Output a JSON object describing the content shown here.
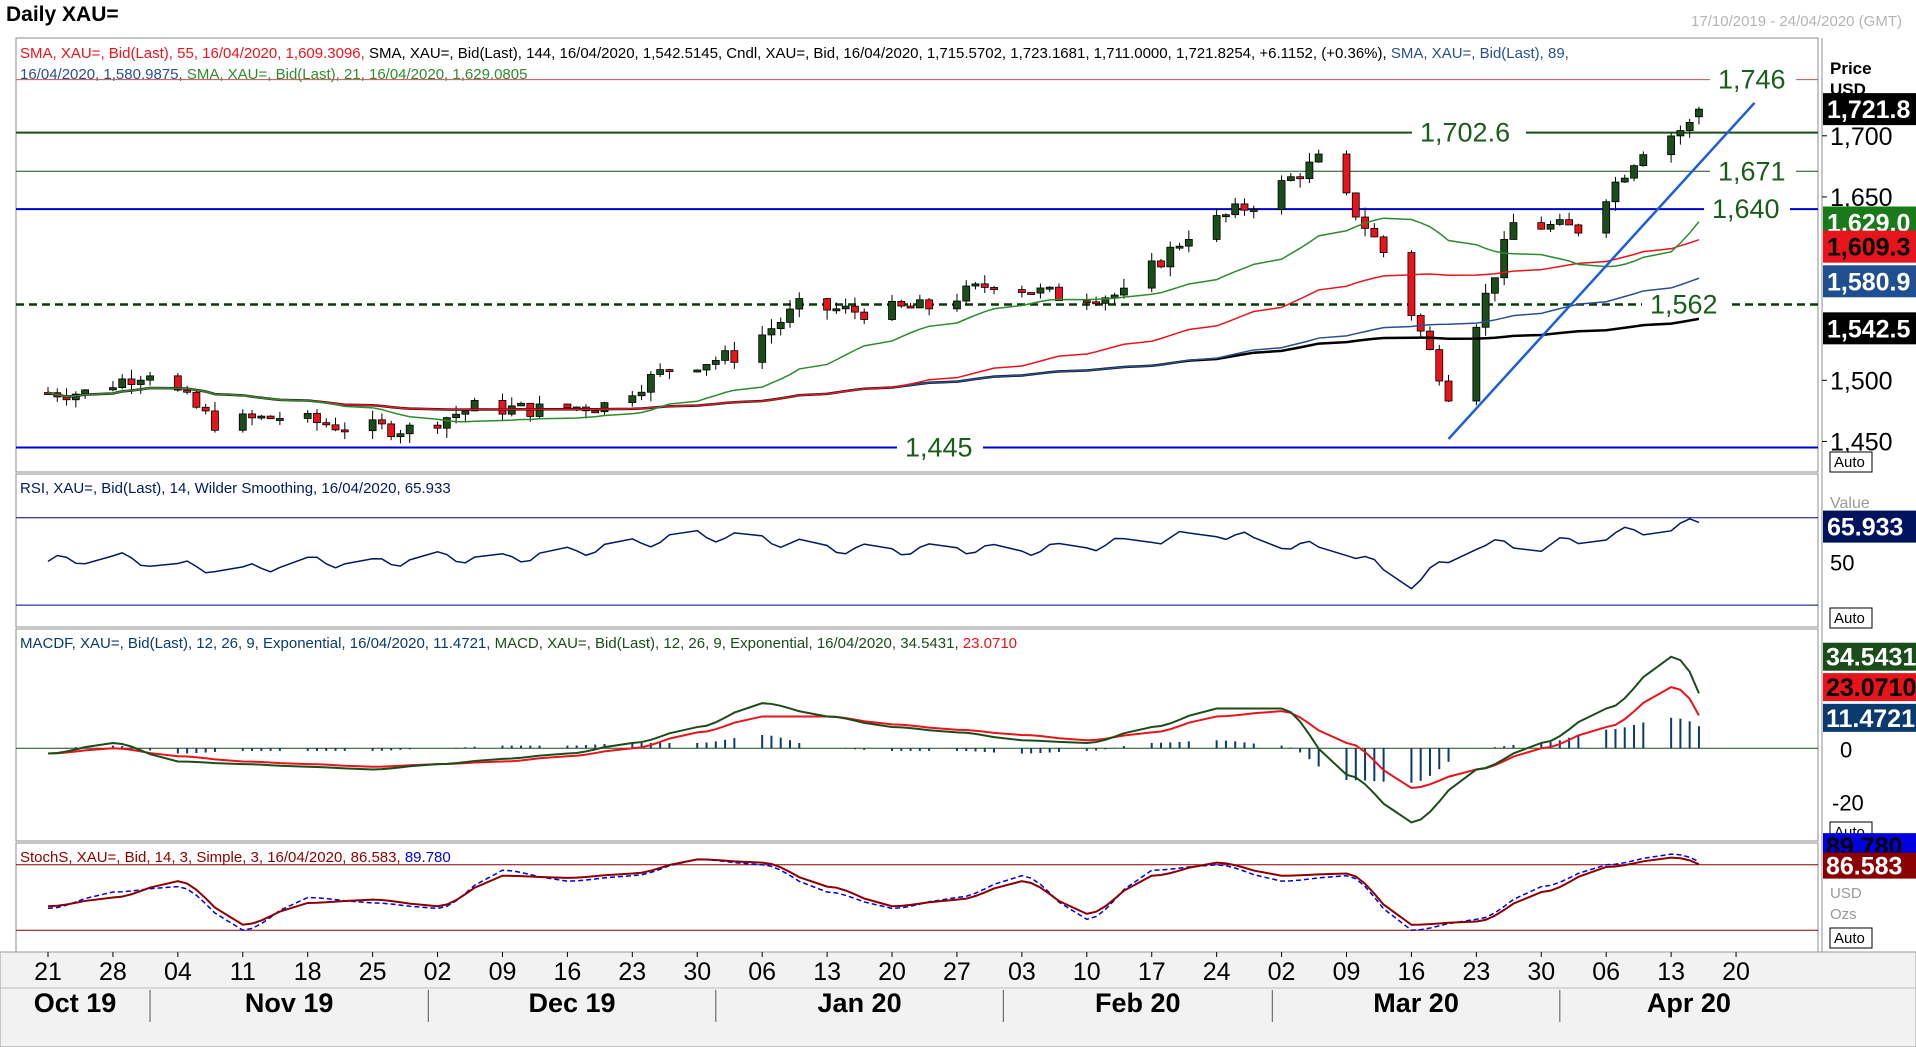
{
  "title": "Daily XAU=",
  "date_range": "17/10/2019 - 24/04/2020 (GMT)",
  "colors": {
    "up": "#1a4d1a",
    "down": "#e8141c",
    "sma21": "#2e8b2e",
    "sma55": "#e8141c",
    "sma89": "#2a4f8f",
    "sma144": "#000000",
    "support": "#0000cc",
    "level_green": "#1a5c1a",
    "trend": "#1f5fd6",
    "rsi": "#001a66",
    "macdf": "#0a3a6e",
    "macd": "#1a4d1a",
    "signal": "#e8141c",
    "stochk": "#0000e0",
    "stochd": "#8b0000"
  },
  "legends": {
    "price_1": [
      {
        "text": "SMA, XAU=, Bid(Last),   55, 16/04/2020, 1,609.3096, ",
        "color": "#e8141c"
      },
      {
        "text": "SMA, XAU=, Bid(Last),   144, 16/04/2020, 1,542.5145, ",
        "color": "#000000"
      },
      {
        "text": "Cndl, XAU=, Bid, 16/04/2020, 1,715.5702, 1,723.1681, 1,711.0000, 1,721.8254, +6.1152, (+0.36%), ",
        "color": "#000000"
      },
      {
        "text": "SMA, XAU=, Bid(Last),   89,",
        "color": "#2a4f8f"
      }
    ],
    "price_2": [
      {
        "text": "16/04/2020, 1,580.9875, ",
        "color": "#2a4f8f"
      },
      {
        "text": "SMA, XAU=, Bid(Last),   21, 16/04/2020, 1,629.0805",
        "color": "#2e8b2e"
      }
    ],
    "rsi": "RSI, XAU=, Bid(Last),   14, Wilder Smoothing, 16/04/2020, 65.933",
    "macd": [
      {
        "text": "MACDF, XAU=, Bid(Last),   12, 26, 9, Exponential, 16/04/2020, 11.4721, ",
        "color": "#0a3a6e"
      },
      {
        "text": "MACD, XAU=, Bid(Last),   12, 26, 9, Exponential, 16/04/2020, 34.5431, ",
        "color": "#1a4d1a"
      },
      {
        "text": "23.0710",
        "color": "#e8141c"
      }
    ],
    "stoch": [
      {
        "text": "StochS, XAU=, Bid,   14, 3, Simple, 3, 16/04/2020, 86.583, ",
        "color": "#8b0000"
      },
      {
        "text": "89.780",
        "color": "#0000e0"
      }
    ]
  },
  "axis": {
    "price_header": "Price",
    "price_unit": "USD",
    "price_ticks": [
      "1,700",
      "1,650",
      "1,500",
      "1,450"
    ],
    "rsi_header": "Value",
    "rsi_unit": "USD",
    "rsi_ticks": [
      "50"
    ],
    "macd_ticks": [
      "0",
      "-20"
    ],
    "stoch_unit_1": "USD",
    "stoch_unit_2": "Ozs",
    "auto": "Auto"
  },
  "badges": {
    "price": [
      {
        "text": "1,721.8",
        "bg": "#000000",
        "fg": "#ffffff"
      },
      {
        "text": "1,629.0",
        "bg": "#1a7a1a",
        "fg": "#ffffff"
      },
      {
        "text": "1,609.3",
        "bg": "#e8141c",
        "fg": "#000000"
      },
      {
        "text": "1,580.9",
        "bg": "#1f4f8f",
        "fg": "#ffffff"
      },
      {
        "text": "1,542.5",
        "bg": "#000000",
        "fg": "#ffffff"
      }
    ],
    "rsi": {
      "text": "65.933",
      "bg": "#00135c",
      "fg": "#ffffff"
    },
    "macd": [
      {
        "text": "34.5431",
        "bg": "#1a4d1a",
        "fg": "#ffffff"
      },
      {
        "text": "23.0710",
        "bg": "#e8141c",
        "fg": "#000000"
      },
      {
        "text": "11.4721",
        "bg": "#0a3a6e",
        "fg": "#ffffff"
      }
    ],
    "stoch": [
      {
        "text": "89.780",
        "bg": "#0000e0",
        "fg": "#000000"
      },
      {
        "text": "86.583",
        "bg": "#8b0000",
        "fg": "#ffffff"
      }
    ]
  },
  "levels": [
    {
      "value": 1746,
      "label": "1,746",
      "color": "#c85050",
      "style": "thin"
    },
    {
      "value": 1702.6,
      "label": "1,702.6",
      "color": "#1a4d1a",
      "style": "solid"
    },
    {
      "value": 1671,
      "label": "1,671",
      "color": "#1a4d1a",
      "style": "thin"
    },
    {
      "value": 1640,
      "label": "1,640",
      "color": "#0000cc",
      "style": "solid"
    },
    {
      "value": 1562,
      "label": "1,562",
      "color": "#0a3a0a",
      "style": "dashed"
    },
    {
      "value": 1445,
      "label": "1,445",
      "color": "#0000cc",
      "style": "solid"
    }
  ],
  "x_axis": {
    "days": [
      "21",
      "28",
      "04",
      "11",
      "18",
      "25",
      "02",
      "09",
      "16",
      "23",
      "30",
      "06",
      "13",
      "20",
      "27",
      "03",
      "10",
      "17",
      "24",
      "02",
      "09",
      "16",
      "23",
      "30",
      "06",
      "13",
      "20"
    ],
    "months": [
      "Oct 19",
      "Nov 19",
      "Dec 19",
      "Jan 20",
      "Feb 20",
      "Mar 20",
      "Apr 20"
    ]
  },
  "chart_data": [
    {
      "type": "candlestick",
      "title": "Daily XAU=",
      "ylabel": "Price USD",
      "ylim": [
        1425,
        1780
      ],
      "x": [
        "2019-10-21",
        "2019-10-28",
        "2019-11-04",
        "2019-11-11",
        "2019-11-18",
        "2019-11-25",
        "2019-12-02",
        "2019-12-09",
        "2019-12-16",
        "2019-12-23",
        "2019-12-30",
        "2020-01-06",
        "2020-01-13",
        "2020-01-20",
        "2020-01-27",
        "2020-02-03",
        "2020-02-10",
        "2020-02-17",
        "2020-02-24",
        "2020-03-02",
        "2020-03-09",
        "2020-03-16",
        "2020-03-23",
        "2020-03-30",
        "2020-04-06",
        "2020-04-13"
      ],
      "close": [
        1490,
        1508,
        1465,
        1470,
        1462,
        1460,
        1478,
        1476,
        1480,
        1510,
        1520,
        1560,
        1556,
        1560,
        1580,
        1569,
        1570,
        1620,
        1645,
        1680,
        1605,
        1490,
        1628,
        1624,
        1690,
        1716
      ],
      "series": [
        {
          "name": "SMA 21",
          "last": 1629.0805
        },
        {
          "name": "SMA 55",
          "last": 1609.3096
        },
        {
          "name": "SMA 89",
          "last": 1580.9875
        },
        {
          "name": "SMA 144",
          "last": 1542.5145
        }
      ],
      "last_candle": {
        "date": "16/04/2020",
        "open": 1715.5702,
        "high": 1723.1681,
        "low": 1711.0,
        "close": 1721.8254,
        "change": 6.1152,
        "change_pct": 0.36
      },
      "annotations": [
        "1,746",
        "1,702.6",
        "1,671",
        "1,640",
        "1,562",
        "1,445"
      ]
    },
    {
      "type": "line",
      "title": "RSI, XAU=, Bid(Last), 14, Wilder Smoothing",
      "ylim": [
        20,
        90
      ],
      "series": [
        {
          "name": "RSI",
          "values": [
            50,
            52,
            48,
            46,
            50,
            49,
            52,
            51,
            54,
            58,
            62,
            60,
            56,
            55,
            56,
            55,
            57,
            60,
            63,
            58,
            55,
            40,
            58,
            57,
            62,
            65.9
          ]
        }
      ],
      "last": 65.933
    },
    {
      "type": "line",
      "title": "MACDF, XAU=, Bid(Last), 12, 26, 9, Exponential",
      "ylim": [
        -35,
        45
      ],
      "series": [
        {
          "name": "MACD",
          "values": [
            -2,
            2,
            -5,
            -6,
            -7,
            -8,
            -6,
            -4,
            -2,
            2,
            8,
            17,
            12,
            8,
            6,
            3,
            2,
            8,
            15,
            15,
            -10,
            -28,
            -8,
            2,
            15,
            34.5431
          ]
        },
        {
          "name": "Signal",
          "values": [
            -2,
            0,
            -3,
            -5,
            -6,
            -7,
            -6,
            -5,
            -3,
            0,
            6,
            12,
            12,
            9,
            7,
            5,
            3,
            6,
            12,
            14,
            2,
            -15,
            -8,
            0,
            8,
            23.071
          ]
        },
        {
          "name": "MACDF",
          "values": [
            0,
            1,
            -2,
            -1,
            -1,
            -1,
            0,
            1,
            1,
            2,
            2,
            5,
            0,
            -1,
            -1,
            -2,
            -1,
            2,
            3,
            1,
            -12,
            -13,
            0,
            2,
            7,
            11.4721
          ]
        }
      ]
    },
    {
      "type": "line",
      "title": "StochS, XAU=, Bid, 14, 3, Simple, 3",
      "ylim": [
        0,
        100
      ],
      "series": [
        {
          "name": "%K",
          "values": [
            40,
            55,
            60,
            20,
            50,
            45,
            40,
            75,
            65,
            70,
            85,
            80,
            55,
            40,
            50,
            70,
            30,
            75,
            80,
            65,
            70,
            20,
            30,
            60,
            80,
            89.78
          ]
        },
        {
          "name": "%D",
          "values": [
            42,
            50,
            65,
            25,
            45,
            48,
            42,
            70,
            68,
            72,
            85,
            82,
            60,
            42,
            48,
            65,
            35,
            70,
            82,
            70,
            72,
            25,
            28,
            55,
            78,
            86.583
          ]
        }
      ]
    }
  ]
}
